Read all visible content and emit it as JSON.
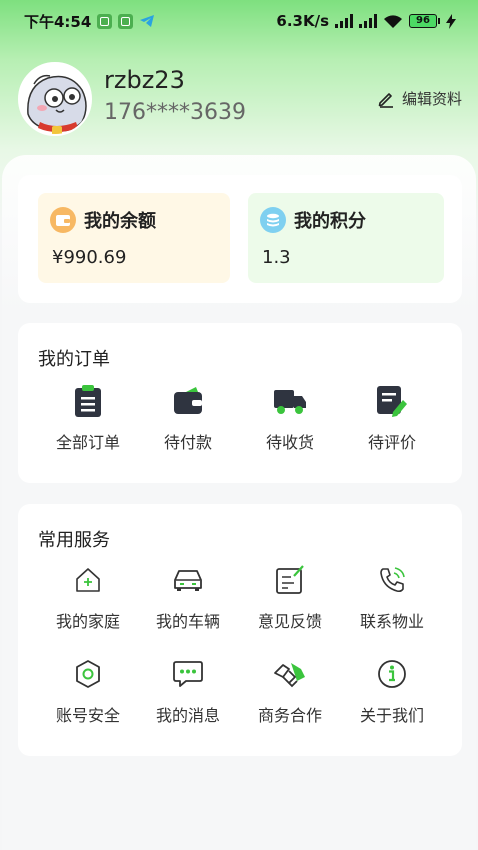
{
  "status_bar": {
    "time": "下午4:54",
    "speed": "6.3K/s",
    "battery": "96"
  },
  "profile": {
    "username": "rzbz23",
    "phone": "176****3639",
    "edit_label": "编辑资料"
  },
  "wallet": {
    "balance_label": "我的余额",
    "balance_value": "¥990.69",
    "points_label": "我的积分",
    "points_value": "1.3"
  },
  "orders": {
    "title": "我的订单",
    "items": [
      {
        "label": "全部订单",
        "icon": "clipboard-icon"
      },
      {
        "label": "待付款",
        "icon": "wallet-icon"
      },
      {
        "label": "待收货",
        "icon": "truck-icon"
      },
      {
        "label": "待评价",
        "icon": "review-icon"
      }
    ]
  },
  "services": {
    "title": "常用服务",
    "items": [
      {
        "label": "我的家庭",
        "icon": "home-icon"
      },
      {
        "label": "我的车辆",
        "icon": "car-icon"
      },
      {
        "label": "意见反馈",
        "icon": "feedback-icon"
      },
      {
        "label": "联系物业",
        "icon": "phone-icon"
      },
      {
        "label": "账号安全",
        "icon": "shield-icon"
      },
      {
        "label": "我的消息",
        "icon": "message-icon"
      },
      {
        "label": "商务合作",
        "icon": "handshake-icon"
      },
      {
        "label": "关于我们",
        "icon": "info-icon"
      }
    ]
  },
  "colors": {
    "accent": "#3bc43d",
    "dark_icon": "#2f3440",
    "balance_bg": "#fff8e6",
    "points_bg": "#edfbea"
  }
}
